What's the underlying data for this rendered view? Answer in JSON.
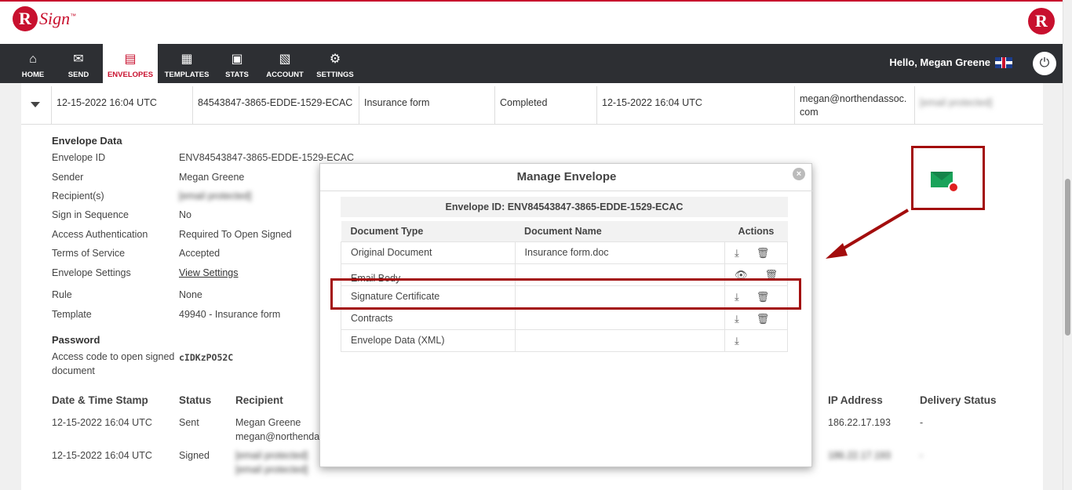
{
  "brand": {
    "logo_letter": "R",
    "logo_text": "Sign",
    "logo_tm": "™"
  },
  "nav": {
    "items": [
      {
        "label": "HOME",
        "icon": "⌂",
        "name": "home"
      },
      {
        "label": "SEND",
        "icon": "✉",
        "name": "send"
      },
      {
        "label": "ENVELOPES",
        "icon": "▤",
        "name": "envelopes"
      },
      {
        "label": "TEMPLATES",
        "icon": "▦",
        "name": "templates"
      },
      {
        "label": "STATS",
        "icon": "▣",
        "name": "stats"
      },
      {
        "label": "ACCOUNT",
        "icon": "▧",
        "name": "account"
      },
      {
        "label": "SETTINGS",
        "icon": "⚙",
        "name": "settings"
      }
    ],
    "active": "ENVELOPES",
    "greeting": "Hello, Megan Greene",
    "power_icon": "⏻"
  },
  "envelope_row": {
    "sent_date": "12-15-2022 16:04 UTC",
    "envelope_code": "84543847-3865-EDDE-1529-ECAC",
    "subject": "Insurance form",
    "status": "Completed",
    "completed_date": "12-15-2022 16:04 UTC",
    "sender_email_1": "megan@northendassoc.",
    "sender_email_2": "com",
    "recipient_email": "[email protected]"
  },
  "envelope_data": {
    "title": "Envelope Data",
    "fields": [
      {
        "label": "Envelope ID",
        "value": "ENV84543847-3865-EDDE-1529-ECAC"
      },
      {
        "label": "Sender",
        "value": "Megan Greene"
      },
      {
        "label": "Recipient(s)",
        "value": "[email protected]"
      },
      {
        "label": "Sign in Sequence",
        "value": "No"
      },
      {
        "label": "Access Authentication",
        "value": "Required To Open Signed"
      },
      {
        "label": "Terms of Service",
        "value": "Accepted"
      },
      {
        "label": "Envelope Settings",
        "value": "View Settings"
      },
      {
        "label": "Rule",
        "value": "None"
      },
      {
        "label": "Template",
        "value": "49940 - Insurance form"
      }
    ],
    "password_title": "Password",
    "password_label_1": "Access code to open signed",
    "password_label_2": "document",
    "password_code": "cIDKzPO52C"
  },
  "history": {
    "headers": {
      "date": "Date & Time Stamp",
      "status": "Status",
      "recipient": "Recipient",
      "ip": "IP Address",
      "delivery": "Delivery Status"
    },
    "rows": [
      {
        "date": "12-15-2022 16:04 UTC",
        "status": "Sent",
        "recipient_name": "Megan Greene",
        "recipient_email": "megan@northenda",
        "ip": "186.22.17.193",
        "delivery": "-"
      },
      {
        "date": "12-15-2022 16:04 UTC",
        "status": "Signed",
        "recipient_name": "[email protected]",
        "recipient_email": "[email protected]",
        "ip": "186.22.17.193",
        "delivery": "-"
      }
    ]
  },
  "modal": {
    "title": "Manage Envelope",
    "close_icon": "×",
    "envelope_id_label": "Envelope ID: ENV84543847-3865-EDDE-1529-ECAC",
    "columns": {
      "type": "Document Type",
      "name": "Document Name",
      "actions": "Actions"
    },
    "documents": [
      {
        "type": "Original Document",
        "name": "Insurance form.doc",
        "actions": [
          "download",
          "delete"
        ]
      },
      {
        "type": "Email Body",
        "name": "",
        "actions": [
          "view",
          "delete"
        ]
      },
      {
        "type": "Signature Certificate",
        "name": "",
        "actions": [
          "download",
          "delete"
        ]
      },
      {
        "type": "Contracts",
        "name": "",
        "actions": [
          "download",
          "delete"
        ]
      },
      {
        "type": "Envelope Data (XML)",
        "name": "",
        "actions": [
          "download"
        ]
      }
    ]
  },
  "icons": {
    "download": "⤓",
    "delete": "🗑",
    "view": "👁"
  },
  "colors": {
    "brand_red": "#c8102e",
    "nav_bg": "#2d2f33",
    "annotation": "#a30d0d",
    "mail_green": "#1aa35a"
  }
}
